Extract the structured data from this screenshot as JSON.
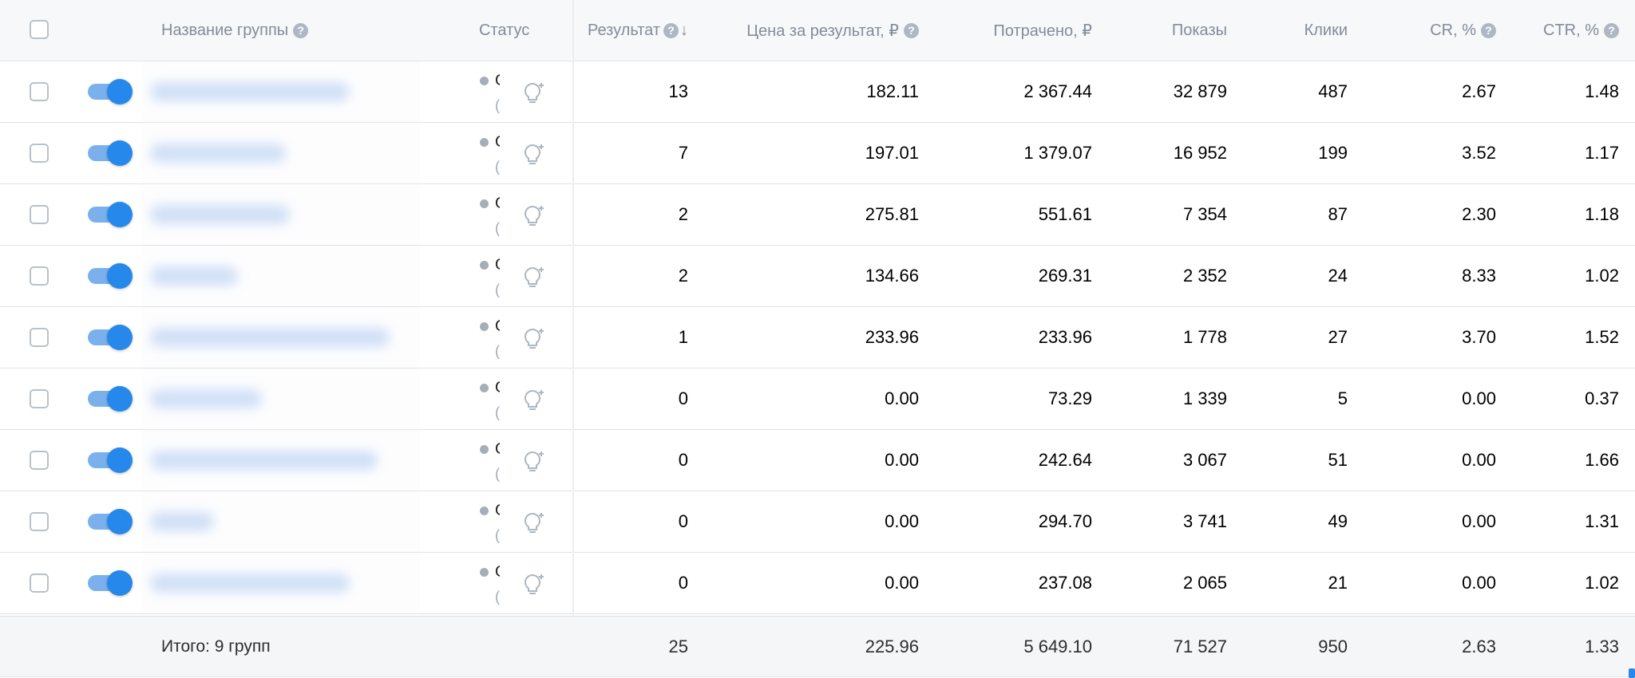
{
  "columns": {
    "group_name": "Название группы",
    "status": "Статус",
    "result": "Результат",
    "price_per_result": "Цена за результат, ₽",
    "spent": "Потрачено, ₽",
    "impressions": "Показы",
    "clicks": "Клики",
    "cr": "CR, %",
    "ctr": "CTR, %"
  },
  "rows": [
    {
      "result": "13",
      "price": "182.11",
      "spent": "2 367.44",
      "impressions": "32 879",
      "clicks": "487",
      "cr": "2.67",
      "ctr": "1.48",
      "status": "О",
      "status_sub": "("
    },
    {
      "result": "7",
      "price": "197.01",
      "spent": "1 379.07",
      "impressions": "16 952",
      "clicks": "199",
      "cr": "3.52",
      "ctr": "1.17",
      "status": "О",
      "status_sub": "("
    },
    {
      "result": "2",
      "price": "275.81",
      "spent": "551.61",
      "impressions": "7 354",
      "clicks": "87",
      "cr": "2.30",
      "ctr": "1.18",
      "status": "О",
      "status_sub": "("
    },
    {
      "result": "2",
      "price": "134.66",
      "spent": "269.31",
      "impressions": "2 352",
      "clicks": "24",
      "cr": "8.33",
      "ctr": "1.02",
      "status": "О",
      "status_sub": "("
    },
    {
      "result": "1",
      "price": "233.96",
      "spent": "233.96",
      "impressions": "1 778",
      "clicks": "27",
      "cr": "3.70",
      "ctr": "1.52",
      "status": "О",
      "status_sub": "("
    },
    {
      "result": "0",
      "price": "0.00",
      "spent": "73.29",
      "impressions": "1 339",
      "clicks": "5",
      "cr": "0.00",
      "ctr": "0.37",
      "status": "О",
      "status_sub": "("
    },
    {
      "result": "0",
      "price": "0.00",
      "spent": "242.64",
      "impressions": "3 067",
      "clicks": "51",
      "cr": "0.00",
      "ctr": "1.66",
      "status": "О",
      "status_sub": "("
    },
    {
      "result": "0",
      "price": "0.00",
      "spent": "294.70",
      "impressions": "3 741",
      "clicks": "49",
      "cr": "0.00",
      "ctr": "1.31",
      "status": "О",
      "status_sub": "("
    },
    {
      "result": "0",
      "price": "0.00",
      "spent": "237.08",
      "impressions": "2 065",
      "clicks": "21",
      "cr": "0.00",
      "ctr": "1.02",
      "status": "О",
      "status_sub": "("
    }
  ],
  "totals": {
    "label": "Итого: 9 групп",
    "result": "25",
    "price": "225.96",
    "spent": "5 649.10",
    "impressions": "71 527",
    "clicks": "950",
    "cr": "2.63",
    "ctr": "1.33"
  },
  "icons": {
    "help": "question-circle-icon",
    "sort": "arrow-down-icon",
    "recommendation": "lightbulb-icon"
  },
  "colors": {
    "accent": "#2688eb",
    "header_text": "#818c99",
    "status_dot": "#a7aeb7"
  }
}
